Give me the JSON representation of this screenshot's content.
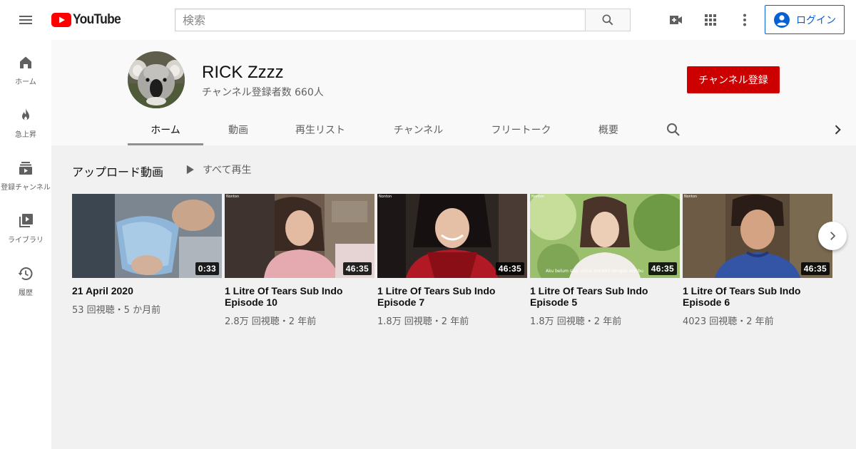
{
  "header": {
    "logo_text": "YouTube",
    "search_placeholder": "検索",
    "login_label": "ログイン",
    "icons": [
      "hamburger-menu-icon",
      "youtube-logo-icon",
      "search-icon",
      "video-camera-add-icon",
      "apps-grid-icon",
      "more-vertical-icon",
      "account-circle-icon"
    ],
    "accent_color": "#ff0000",
    "link_color": "#065fd4"
  },
  "sidebar": {
    "items": [
      {
        "label": "ホーム",
        "icon": "home-icon"
      },
      {
        "label": "急上昇",
        "icon": "flame-icon"
      },
      {
        "label": "登録チャンネル",
        "icon": "subscriptions-icon"
      },
      {
        "label": "ライブラリ",
        "icon": "library-icon"
      },
      {
        "label": "履歴",
        "icon": "history-icon"
      }
    ]
  },
  "channel": {
    "name": "RICK Zzzz",
    "subscriber_count": "チャンネル登録者数 660人",
    "subscribe_label": "チャンネル登録",
    "subscribe_color": "#cc0000",
    "tabs": [
      {
        "label": "ホーム",
        "active": true
      },
      {
        "label": "動画",
        "active": false
      },
      {
        "label": "再生リスト",
        "active": false
      },
      {
        "label": "チャンネル",
        "active": false
      },
      {
        "label": "フリートーク",
        "active": false
      },
      {
        "label": "概要",
        "active": false
      }
    ]
  },
  "shelf": {
    "title": "アップロード動画",
    "play_all_label": "すべて再生",
    "videos": [
      {
        "title": "21 April 2020",
        "meta": "53 回視聴・5 か月前",
        "duration": "0:33"
      },
      {
        "title": "1 Litre Of Tears Sub Indo Episode 10",
        "meta": "2.8万 回視聴・2 年前",
        "duration": "46:35"
      },
      {
        "title": "1 Litre Of Tears Sub Indo Episode 7",
        "meta": "1.8万 回視聴・2 年前",
        "duration": "46:35"
      },
      {
        "title": "1 Litre Of Tears Sub Indo Episode 5",
        "meta": "1.8万 回視聴・2 年前",
        "duration": "46:35"
      },
      {
        "title": "1 Litre Of Tears Sub Indo Episode 6",
        "meta": "4023 回視聴・2 年前",
        "duration": "46:35"
      }
    ],
    "thumbnail_badge": "Nonton",
    "episode5_subtitle": "Aku belum siap untuk berlatih dengan sembu"
  }
}
